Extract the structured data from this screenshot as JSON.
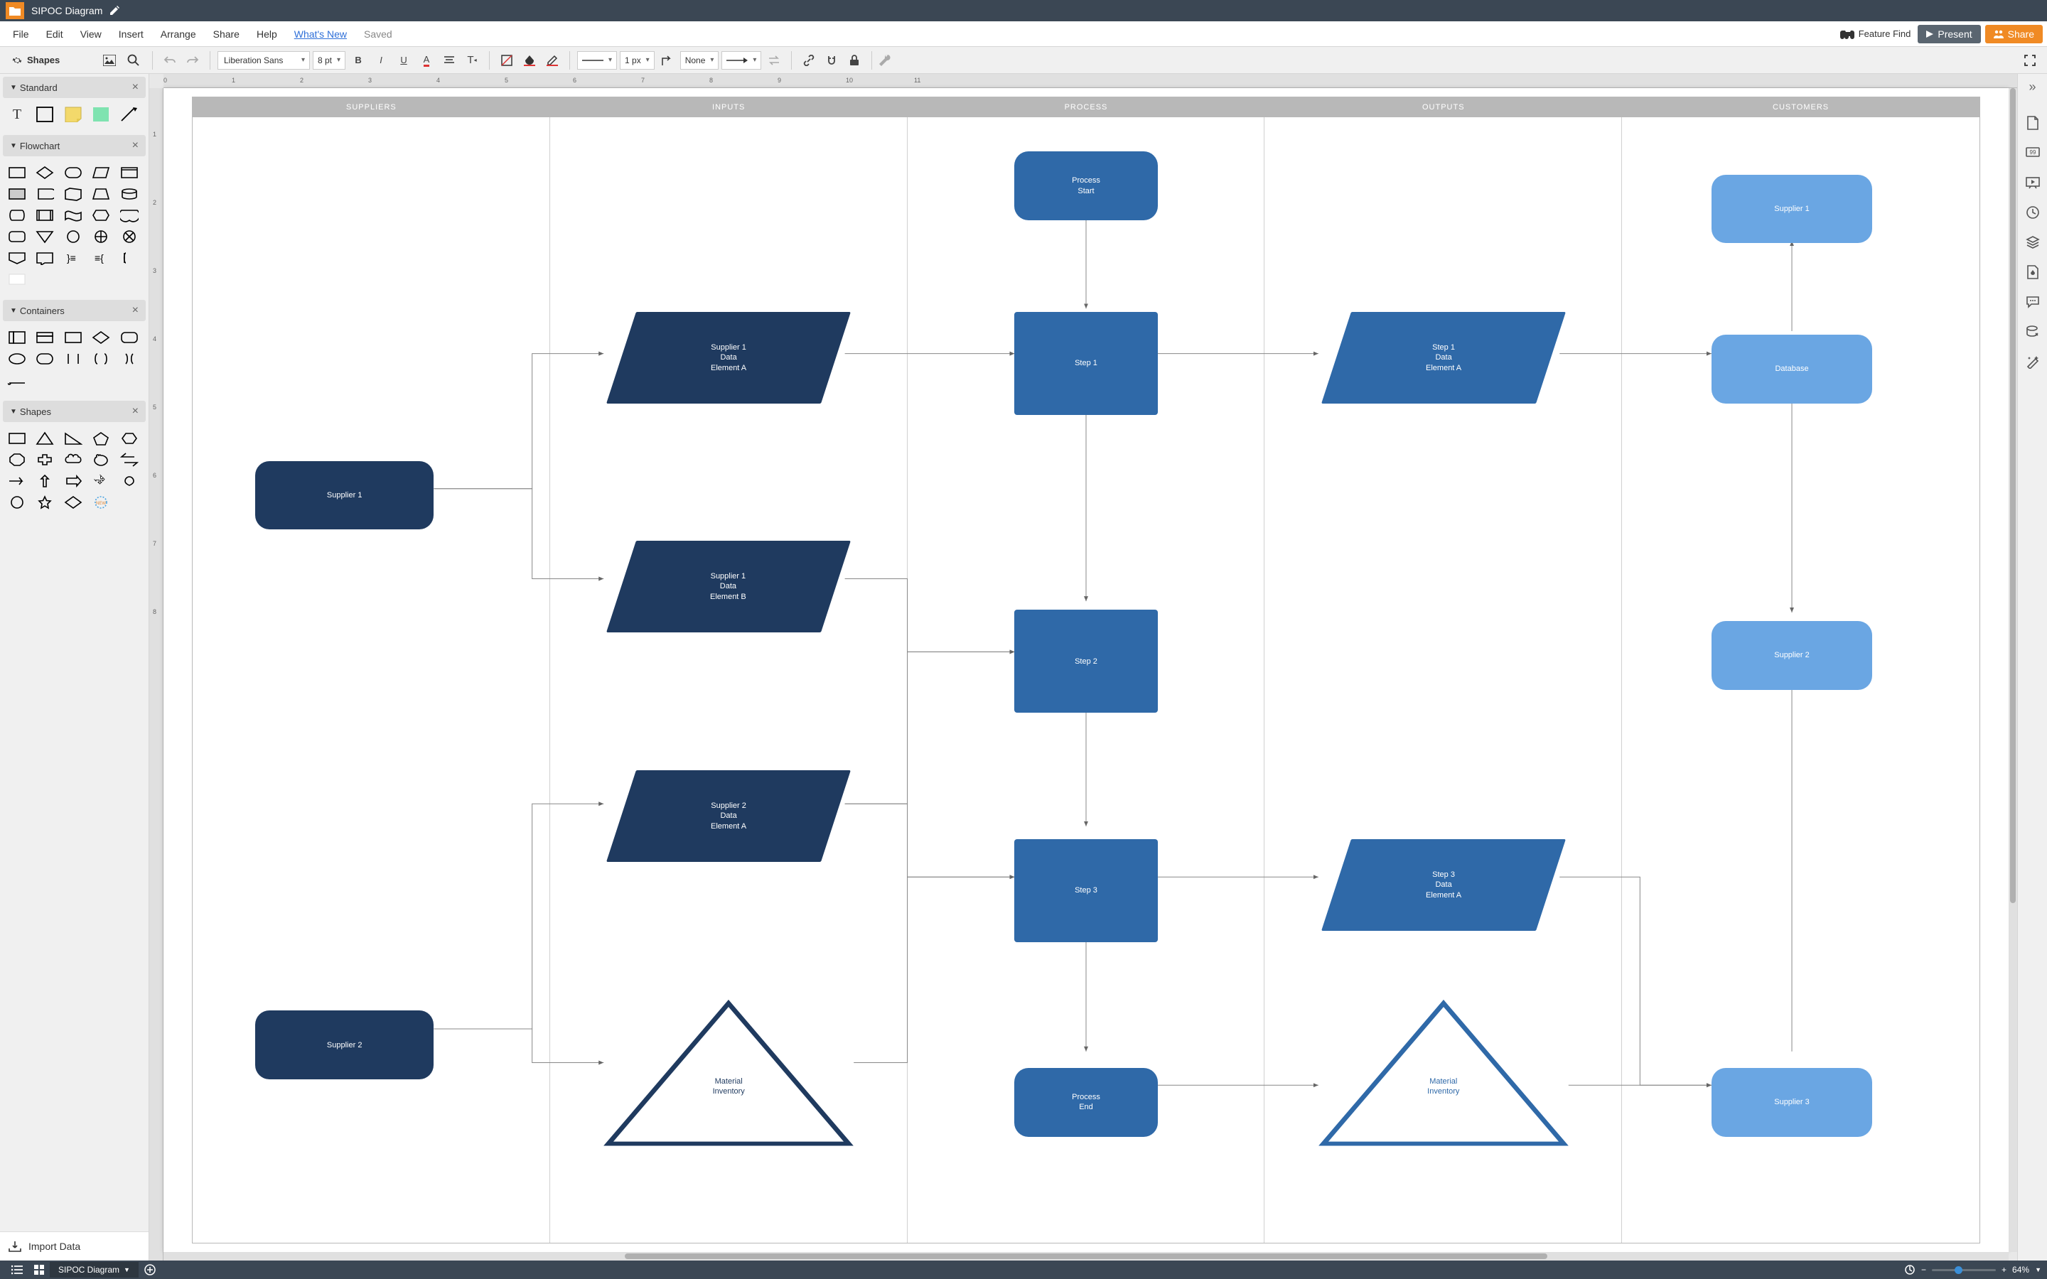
{
  "titlebar": {
    "doc_title": "SIPOC Diagram"
  },
  "menu": {
    "items": [
      "File",
      "Edit",
      "View",
      "Insert",
      "Arrange",
      "Share",
      "Help"
    ],
    "whats_new": "What's New",
    "saved": "Saved",
    "feature_find": "Feature Find",
    "present": "Present",
    "share": "Share"
  },
  "toolbar": {
    "shapes_label": "Shapes",
    "font": "Liberation Sans",
    "font_size": "8 pt",
    "stroke_width": "1 px",
    "line_style": "None"
  },
  "shape_sections": {
    "standard": "Standard",
    "flowchart": "Flowchart",
    "containers": "Containers",
    "shapes": "Shapes"
  },
  "import_data": "Import Data",
  "sipoc": {
    "headers": [
      "SUPPLIERS",
      "INPUTS",
      "PROCESS",
      "OUTPUTS",
      "CUSTOMERS"
    ],
    "suppliers": {
      "sup1": "Supplier 1",
      "sup2": "Supplier 2"
    },
    "inputs": {
      "s1a": "Supplier 1\nData\nElement A",
      "s1b": "Supplier 1\nData\nElement B",
      "s2a": "Supplier 2\nData\nElement A",
      "mat": "Material\nInventory"
    },
    "process": {
      "start": "Process\nStart",
      "step1": "Step 1",
      "step2": "Step 2",
      "step3": "Step 3",
      "end": "Process\nEnd"
    },
    "outputs": {
      "s1a": "Step 1\nData\nElement A",
      "s3a": "Step 3\nData\nElement A",
      "mat": "Material\nInventory"
    },
    "customers": {
      "c1": "Supplier 1",
      "db": "Database",
      "c2": "Supplier 2",
      "c3": "Supplier 3"
    }
  },
  "ruler_h": [
    "0",
    "1",
    "2",
    "3",
    "4",
    "5",
    "6",
    "7",
    "8",
    "9",
    "10",
    "11"
  ],
  "ruler_v": [
    "1",
    "2",
    "3",
    "4",
    "5",
    "6",
    "7",
    "8"
  ],
  "status": {
    "page_tab": "SIPOC Diagram",
    "zoom_label": "64%",
    "zoom_pos_pct": 35
  },
  "colors": {
    "dark_navy": "#1f3a5f",
    "mid_blue": "#2f69a8",
    "light_blue": "#6aa6e3",
    "outline_blue": "#2b5f9e",
    "header_grey": "#b8b8b8",
    "orange": "#f08a24"
  },
  "chart_data": {
    "type": "swimlane-flowchart",
    "title": "SIPOC Diagram",
    "lanes": [
      "SUPPLIERS",
      "INPUTS",
      "PROCESS",
      "OUTPUTS",
      "CUSTOMERS"
    ],
    "nodes": [
      {
        "id": "sup1",
        "lane": "SUPPLIERS",
        "label": "Supplier 1",
        "shape": "terminator",
        "fill": "#1f3a5f"
      },
      {
        "id": "sup2",
        "lane": "SUPPLIERS",
        "label": "Supplier 2",
        "shape": "terminator",
        "fill": "#1f3a5f"
      },
      {
        "id": "in_s1a",
        "lane": "INPUTS",
        "label": "Supplier 1 Data Element A",
        "shape": "parallelogram",
        "fill": "#1f3a5f"
      },
      {
        "id": "in_s1b",
        "lane": "INPUTS",
        "label": "Supplier 1 Data Element B",
        "shape": "parallelogram",
        "fill": "#1f3a5f"
      },
      {
        "id": "in_s2a",
        "lane": "INPUTS",
        "label": "Supplier 2 Data Element A",
        "shape": "parallelogram",
        "fill": "#1f3a5f"
      },
      {
        "id": "in_mat",
        "lane": "INPUTS",
        "label": "Material Inventory",
        "shape": "triangle",
        "fill": "none",
        "stroke": "#2b5f9e"
      },
      {
        "id": "p_start",
        "lane": "PROCESS",
        "label": "Process Start",
        "shape": "terminator",
        "fill": "#2f69a8"
      },
      {
        "id": "p_1",
        "lane": "PROCESS",
        "label": "Step 1",
        "shape": "process",
        "fill": "#2f69a8"
      },
      {
        "id": "p_2",
        "lane": "PROCESS",
        "label": "Step 2",
        "shape": "process",
        "fill": "#2f69a8"
      },
      {
        "id": "p_3",
        "lane": "PROCESS",
        "label": "Step 3",
        "shape": "process",
        "fill": "#2f69a8"
      },
      {
        "id": "p_end",
        "lane": "PROCESS",
        "label": "Process End",
        "shape": "terminator",
        "fill": "#2f69a8"
      },
      {
        "id": "out_s1a",
        "lane": "OUTPUTS",
        "label": "Step 1 Data Element A",
        "shape": "parallelogram",
        "fill": "#2f69a8"
      },
      {
        "id": "out_s3a",
        "lane": "OUTPUTS",
        "label": "Step 3 Data Element A",
        "shape": "parallelogram",
        "fill": "#2f69a8"
      },
      {
        "id": "out_mat",
        "lane": "OUTPUTS",
        "label": "Material Inventory",
        "shape": "triangle",
        "fill": "none",
        "stroke": "#2b5f9e"
      },
      {
        "id": "c1",
        "lane": "CUSTOMERS",
        "label": "Supplier 1",
        "shape": "terminator",
        "fill": "#6aa6e3"
      },
      {
        "id": "db",
        "lane": "CUSTOMERS",
        "label": "Database",
        "shape": "terminator",
        "fill": "#6aa6e3"
      },
      {
        "id": "c2",
        "lane": "CUSTOMERS",
        "label": "Supplier 2",
        "shape": "terminator",
        "fill": "#6aa6e3"
      },
      {
        "id": "c3",
        "lane": "CUSTOMERS",
        "label": "Supplier 3",
        "shape": "terminator",
        "fill": "#6aa6e3"
      }
    ],
    "edges": [
      {
        "from": "sup1",
        "to": "in_s1a"
      },
      {
        "from": "sup1",
        "to": "in_s1b"
      },
      {
        "from": "sup2",
        "to": "in_s2a"
      },
      {
        "from": "sup2",
        "to": "in_mat"
      },
      {
        "from": "in_s1a",
        "to": "p_1"
      },
      {
        "from": "in_s1b",
        "to": "p_2"
      },
      {
        "from": "in_s2a",
        "to": "p_2"
      },
      {
        "from": "in_s2a",
        "to": "p_3"
      },
      {
        "from": "in_mat",
        "to": "p_3"
      },
      {
        "from": "p_start",
        "to": "p_1"
      },
      {
        "from": "p_1",
        "to": "p_2"
      },
      {
        "from": "p_2",
        "to": "p_3"
      },
      {
        "from": "p_3",
        "to": "p_end"
      },
      {
        "from": "p_1",
        "to": "out_s1a"
      },
      {
        "from": "p_3",
        "to": "out_s3a"
      },
      {
        "from": "p_end",
        "to": "out_mat"
      },
      {
        "from": "out_s1a",
        "to": "db"
      },
      {
        "from": "out_s3a",
        "to": "c3"
      },
      {
        "from": "out_mat",
        "to": "c3"
      },
      {
        "from": "db",
        "to": "c1"
      },
      {
        "from": "db",
        "to": "c2"
      },
      {
        "from": "c3",
        "to": "c2"
      }
    ]
  }
}
